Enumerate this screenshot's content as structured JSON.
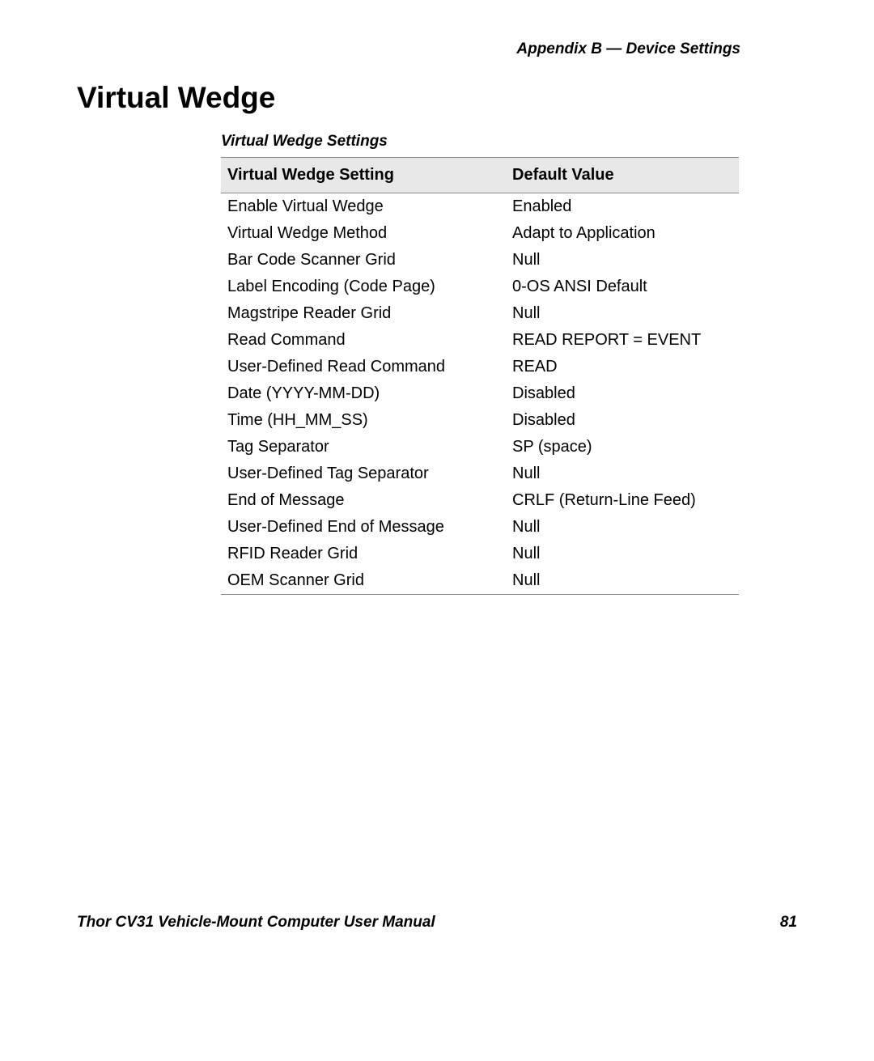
{
  "header": {
    "appendix": "Appendix B — Device Settings"
  },
  "title": "Virtual Wedge",
  "table": {
    "caption": "Virtual Wedge Settings",
    "headers": {
      "setting": "Virtual Wedge Setting",
      "value": "Default Value"
    },
    "rows": [
      {
        "setting": "Enable Virtual Wedge",
        "value": "Enabled"
      },
      {
        "setting": "Virtual Wedge Method",
        "value": "Adapt to Application"
      },
      {
        "setting": "Bar Code Scanner Grid",
        "value": "Null"
      },
      {
        "setting": "Label Encoding (Code Page)",
        "value": "0-OS ANSI Default"
      },
      {
        "setting": "Magstripe Reader Grid",
        "value": "Null"
      },
      {
        "setting": "Read Command",
        "value": "READ REPORT = EVENT"
      },
      {
        "setting": "User-Defined Read Command",
        "value": "READ"
      },
      {
        "setting": "Date (YYYY-MM-DD)",
        "value": "Disabled"
      },
      {
        "setting": "Time (HH_MM_SS)",
        "value": "Disabled"
      },
      {
        "setting": "Tag Separator",
        "value": "SP (space)"
      },
      {
        "setting": "User-Defined Tag Separator",
        "value": "Null"
      },
      {
        "setting": "End of Message",
        "value": "CRLF (Return-Line Feed)"
      },
      {
        "setting": "User-Defined End of Message",
        "value": "Null"
      },
      {
        "setting": "RFID Reader Grid",
        "value": "Null"
      },
      {
        "setting": "OEM Scanner Grid",
        "value": "Null"
      }
    ]
  },
  "footer": {
    "manual": "Thor CV31 Vehicle-Mount Computer User Manual",
    "page": "81"
  }
}
